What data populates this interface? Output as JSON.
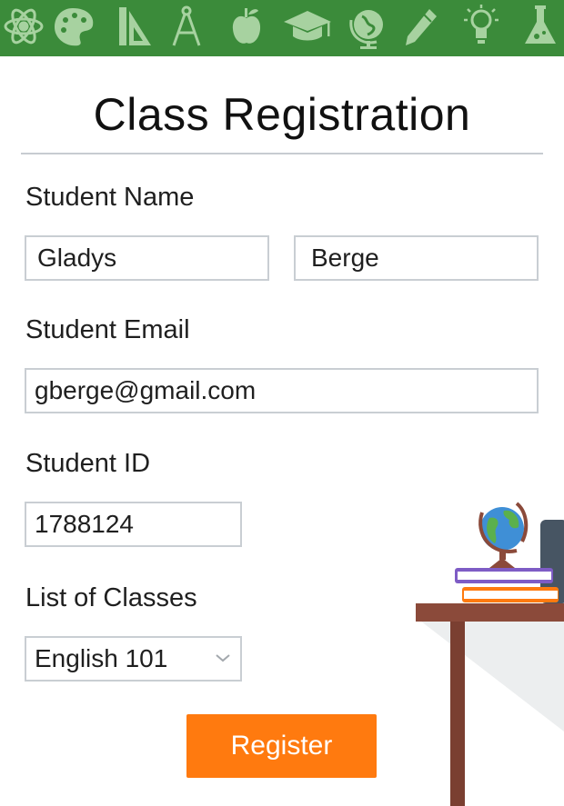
{
  "header": {
    "title": "Class Registration",
    "banner_color": "#3b8b3a",
    "icons": [
      "atom-icon",
      "palette-icon",
      "ruler-triangle-icon",
      "compass-icon",
      "apple-icon",
      "graduation-cap-icon",
      "globe-icon",
      "pencil-icon",
      "lightbulb-icon",
      "flask-icon"
    ]
  },
  "form": {
    "student_name": {
      "label": "Student Name",
      "first_name": "Gladys",
      "last_name": "Berge"
    },
    "student_email": {
      "label": "Student Email",
      "value": "gberge@gmail.com"
    },
    "student_id": {
      "label": "Student ID",
      "value": "1788124"
    },
    "classes": {
      "label": "List of Classes",
      "selected": "English 101"
    },
    "register_label": "Register",
    "accent_color": "#ff7a0f"
  }
}
